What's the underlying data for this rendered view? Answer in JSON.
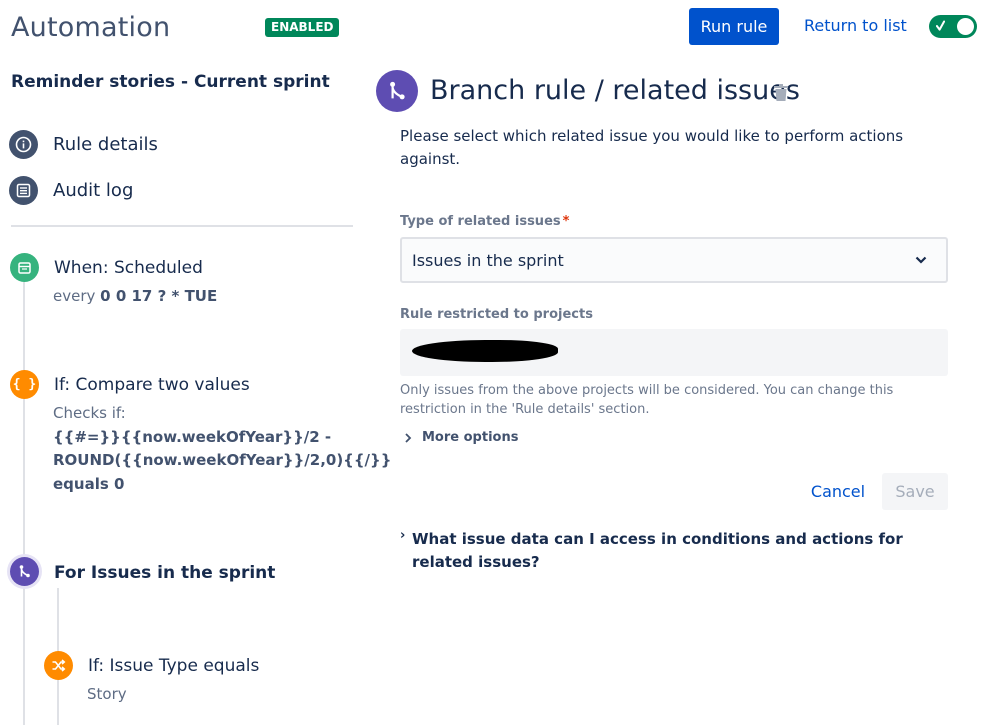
{
  "header": {
    "title": "Automation",
    "status_badge": "ENABLED",
    "run_rule_label": "Run rule",
    "return_label": "Return to list",
    "toggle_on": true
  },
  "sidebar": {
    "rule_name": "Reminder stories - Current sprint",
    "nav": [
      {
        "label": "Rule details",
        "icon": "info-icon"
      },
      {
        "label": "Audit log",
        "icon": "list-icon"
      }
    ],
    "steps": {
      "trigger": {
        "title": "When: Scheduled",
        "sub_prefix": "every",
        "sub_value": "0 0 17 ? * TUE",
        "icon": "calendar-icon",
        "color": "#36b37e"
      },
      "condition": {
        "title": "If: Compare two values",
        "sub_prefix": "Checks if:",
        "line1": "{{#=}}{{now.weekOfYear}}/2 -",
        "line2": "ROUND({{now.weekOfYear}}/2,0){{/}}",
        "line3": "equals 0",
        "icon": "braces-icon",
        "color": "#ff8b00"
      },
      "branch": {
        "title": "For Issues in the sprint",
        "icon": "branch-icon",
        "color": "#5e4db2"
      },
      "sub_condition": {
        "title": "If: Issue Type equals",
        "sub": "Story",
        "icon": "shuffle-icon",
        "color": "#ff8b00"
      }
    }
  },
  "panel": {
    "title": "Branch rule / related issues",
    "description": "Please select which related issue you would like to perform actions against.",
    "type_label": "Type of related issues",
    "required_mark": "*",
    "type_value": "Issues in the sprint",
    "projects_label": "Rule restricted to projects",
    "help_text": "Only issues from the above projects will be considered. You can change this restriction in the 'Rule details' section.",
    "more_options_label": "More options",
    "cancel_label": "Cancel",
    "save_label": "Save",
    "faq_label": "What issue data can I access in conditions and actions for related issues?"
  },
  "colors": {
    "primary": "#0052cc",
    "success": "#00875a",
    "purple": "#5e4db2",
    "orange": "#ff8b00",
    "green": "#36b37e"
  }
}
